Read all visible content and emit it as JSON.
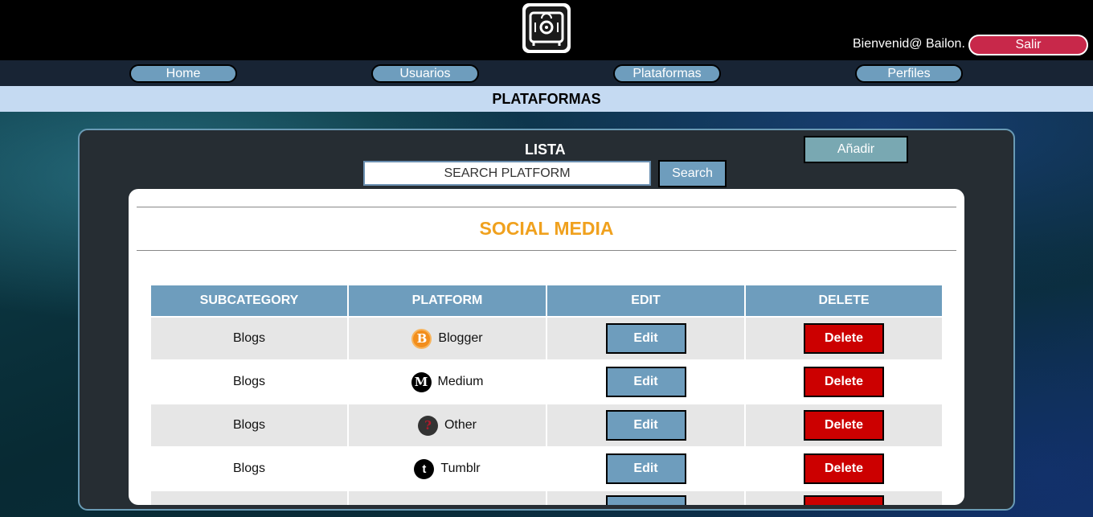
{
  "header": {
    "welcome": "Bienvenid@ Bailon.",
    "logout_label": "Salir"
  },
  "nav": {
    "items": [
      {
        "label": "Home"
      },
      {
        "label": "Usuarios"
      },
      {
        "label": "Plataformas"
      },
      {
        "label": "Perfiles"
      }
    ]
  },
  "page_title": "PLATAFORMAS",
  "panel": {
    "title": "LISTA",
    "add_label": "Añadir",
    "search_placeholder": "SEARCH PLATFORM",
    "search_label": "Search"
  },
  "card": {
    "title": "SOCIAL MEDIA",
    "columns": [
      "SUBCATEGORY",
      "PLATFORM",
      "EDIT",
      "DELETE"
    ],
    "rows": [
      {
        "subcategory": "Blogs",
        "platform": "Blogger",
        "icon": "blogger-icon",
        "edit": "Edit",
        "delete": "Delete"
      },
      {
        "subcategory": "Blogs",
        "platform": "Medium",
        "icon": "medium-icon",
        "edit": "Edit",
        "delete": "Delete"
      },
      {
        "subcategory": "Blogs",
        "platform": "Other",
        "icon": "question-icon",
        "edit": "Edit",
        "delete": "Delete"
      },
      {
        "subcategory": "Blogs",
        "platform": "Tumblr",
        "icon": "tumblr-icon",
        "edit": "Edit",
        "delete": "Delete"
      }
    ]
  },
  "colors": {
    "accent": "#6e9dbd",
    "danger": "#cc0000",
    "logout": "#c8284a",
    "card_title": "#f0a11e"
  }
}
